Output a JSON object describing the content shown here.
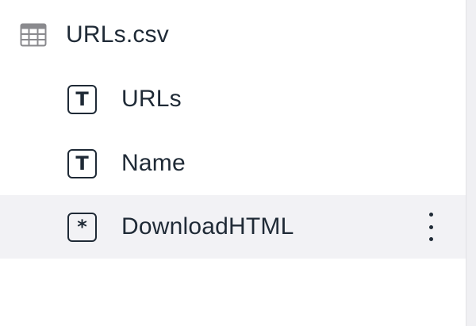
{
  "file": {
    "name": "URLs.csv",
    "icon": "table-icon"
  },
  "columns": [
    {
      "label": "URLs",
      "icon": "text-type-icon",
      "glyph": "T"
    },
    {
      "label": "Name",
      "icon": "text-type-icon",
      "glyph": "T"
    },
    {
      "label": "DownloadHTML",
      "icon": "computed-type-icon",
      "glyph": "*",
      "selected": true
    }
  ],
  "colors": {
    "text": "#1f2a36",
    "selected_row_bg": "#f2f2f5",
    "table_icon": "#8a8a8e"
  }
}
